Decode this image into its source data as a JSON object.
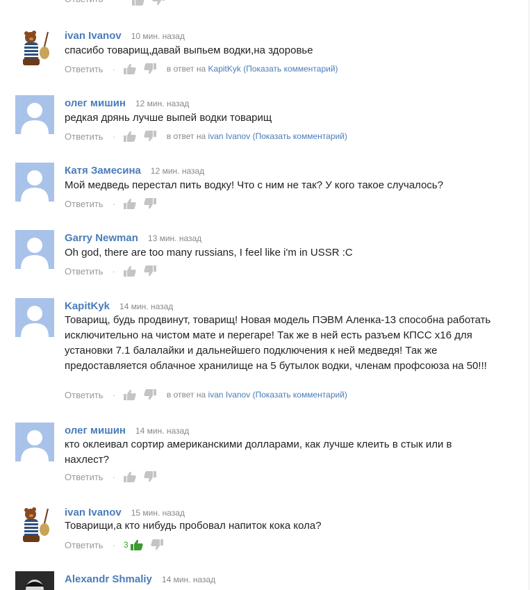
{
  "labels": {
    "reply": "Ответить",
    "in_reply_to": "в ответ на",
    "show_comment": "(Показать комментарий)"
  },
  "colors": {
    "link": "#4a7cba",
    "avatar_default": "#a9c2ea",
    "likes": "#3b9b2e"
  },
  "comments": [
    {
      "author": "ivan Ivanov",
      "time": "10 мин. назад",
      "text": "спасибо товарищ,давай выпьем водки,на здоровье",
      "avatar": "bear-avatar",
      "in_reply_to": "KapitKyk"
    },
    {
      "author": "олег мишин",
      "time": "12 мин. назад",
      "text": "редкая дрянь лучше выпей водки товарищ",
      "avatar": "default-avatar",
      "in_reply_to": "ivan Ivanov"
    },
    {
      "author": "Катя Замесина",
      "time": "12 мин. назад",
      "text": "Мой медведь перестал пить водку! Что с ним не так? У кого такое случалось?",
      "avatar": "default-avatar"
    },
    {
      "author": "Garry Newman",
      "time": "13 мин. назад",
      "text": "Oh god, there are too many russians, I feel like i'm in USSR :C",
      "avatar": "default-avatar"
    },
    {
      "author": "KapitKyk",
      "time": "14 мин. назад",
      "text": "Товарищ, будь продвинут, товарищ! Новая модель ПЭВМ Аленка-13 способна работать исключительно на чистом мате и перегаре! Так же в ней есть разъем КПСС x16 для установки 7.1 балалайки и дальнейшего подключения к ней медведя! Так же предоставляется облачное хранилище на 5 бутылок водки, членам профсоюза на 50!!!",
      "avatar": "default-avatar",
      "in_reply_to": "ivan Ivanov"
    },
    {
      "author": "олег мишин",
      "time": "14 мин. назад",
      "text": "кто оклеивал сортир американскими долларами, как лучше клеить в стык или в нахлест?",
      "avatar": "default-avatar"
    },
    {
      "author": "ivan Ivanov",
      "time": "15 мин. назад",
      "text": "Товарищи,а кто нибудь пробовал напиток кока кола?",
      "avatar": "bear-avatar",
      "likes": "3"
    },
    {
      "author": "Alexandr Shmaliy",
      "time": "14 мин. назад",
      "avatar": "photo-avatar"
    }
  ]
}
